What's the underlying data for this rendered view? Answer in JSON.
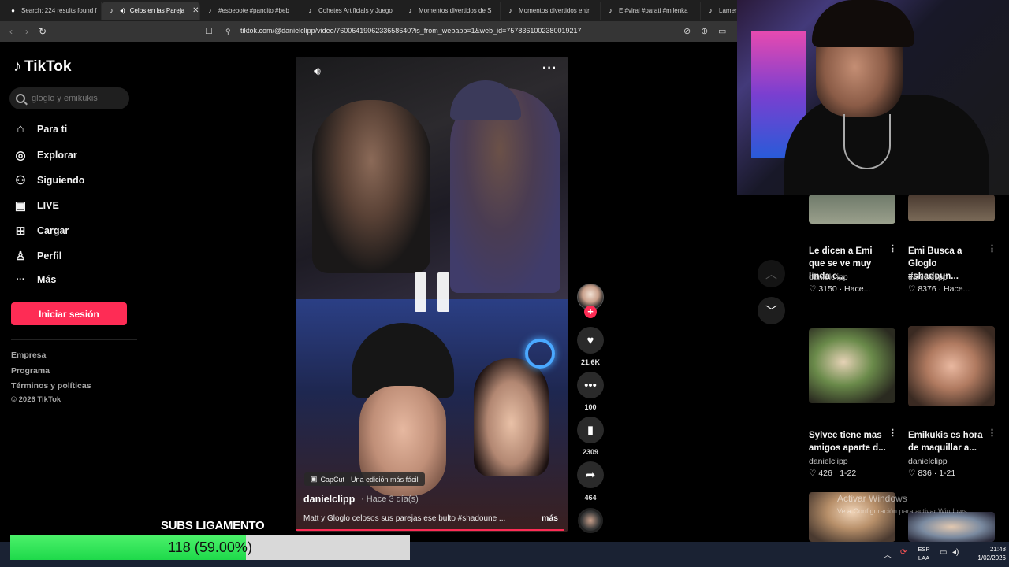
{
  "browser": {
    "tabs": [
      {
        "label": "Search: 224 results found f",
        "fav": "●"
      },
      {
        "label": "Celos en las Pareja",
        "fav": "♪",
        "active": true,
        "close": "✕"
      },
      {
        "label": "#esbebote #pancito #beb",
        "fav": "♪"
      },
      {
        "label": "Cohetes Artificials y Juego",
        "fav": "♪"
      },
      {
        "label": "Momentos divertidos de S",
        "fav": "♪"
      },
      {
        "label": "Momentos divertidos entr",
        "fav": "♪"
      },
      {
        "label": "E #viral #parati #milenka",
        "fav": "♪"
      },
      {
        "label": "Lamen",
        "fav": "♪"
      }
    ],
    "url": "tiktok.com/@danielclipp/video/7600641906233658640?is_from_webapp=1&web_id=7578361002380019217",
    "nav": {
      "back": "‹",
      "forward": "›",
      "reload": "↻"
    }
  },
  "sidebar": {
    "logo": "TikTok",
    "search_placeholder": "gloglo y emikukis",
    "items": [
      {
        "label": "Para ti",
        "icon": "⌂"
      },
      {
        "label": "Explorar",
        "icon": "◎"
      },
      {
        "label": "Siguiendo",
        "icon": "⚇"
      },
      {
        "label": "LIVE",
        "icon": "▣"
      },
      {
        "label": "Cargar",
        "icon": "⊞"
      },
      {
        "label": "Perfil",
        "icon": "♙"
      },
      {
        "label": "Más",
        "icon": "···"
      }
    ],
    "login": "Iniciar sesión",
    "footer": [
      "Empresa",
      "Programa",
      "Términos y políticas",
      "© 2026 TikTok"
    ]
  },
  "video": {
    "capcut": "CapCut · Una edición más fácil",
    "author": "danielclipp",
    "time": "· Hace 3 día(s)",
    "description": "Matt y Gloglo celosos sus parejas ese bulto #shadoune ...",
    "more": "más",
    "actions": {
      "likes": "21.6K",
      "comments": "100",
      "saves": "2309",
      "shares": "464"
    }
  },
  "suggestions": [
    {
      "title": "Le dicen a Emi que se ve muy linda e...",
      "author": "danielclipp",
      "likes": "3150",
      "date": "Hace..."
    },
    {
      "title": "Emi Busca a Gloglo #shadoun...",
      "author": "danielclipp",
      "likes": "8376",
      "date": "Hace..."
    },
    {
      "title": "Sylvee tiene mas amigos aparte d...",
      "author": "danielclipp",
      "likes": "426",
      "date": "1-22"
    },
    {
      "title": "Emikukis es hora de maquillar a...",
      "author": "danielclipp",
      "likes": "836",
      "date": "1-21"
    }
  ],
  "windows": {
    "watermark": "Activar Windows",
    "watermark_sub": "Ve a Configuración para activar Windows.",
    "lang_top": "ESP",
    "lang_bottom": "LAA",
    "time": "21:48",
    "date": "1/02/2026"
  },
  "subs": {
    "title": "SUBS LIGAMENTO",
    "text": "118 (59.00%)",
    "progress": 0.59
  },
  "colors": {
    "accent": "#fe2c55",
    "progress_green": "#1ed94a"
  }
}
